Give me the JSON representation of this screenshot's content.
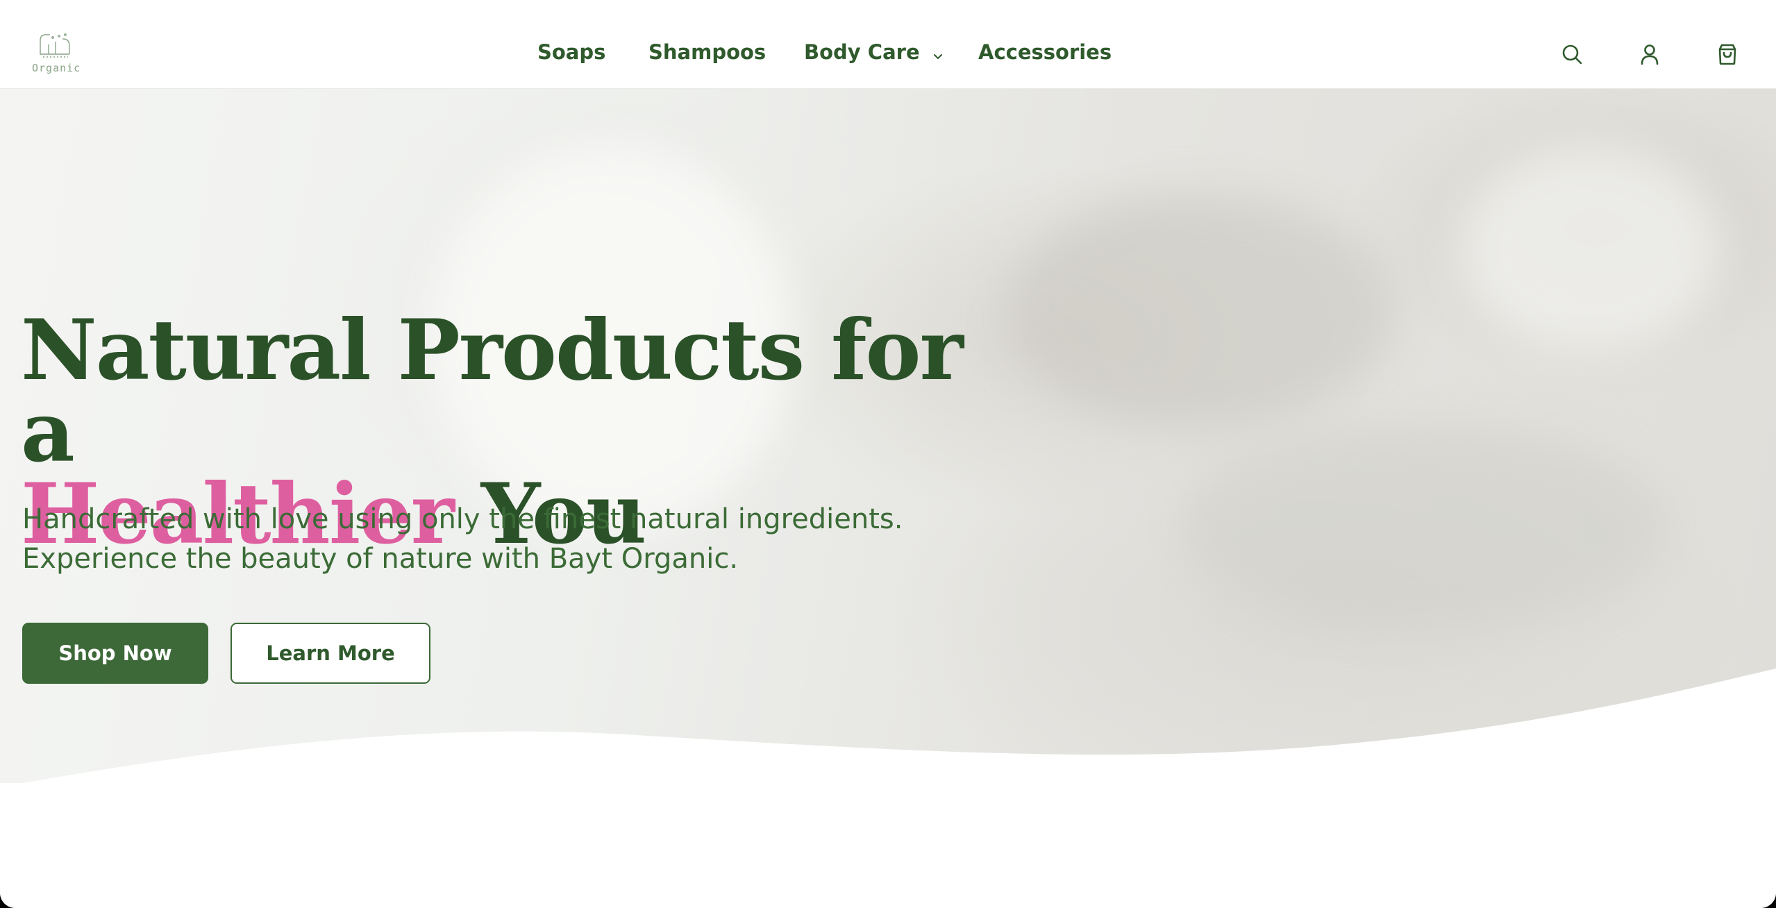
{
  "brand": {
    "logo_text": "Organic",
    "name": "Bayt Organic"
  },
  "nav": {
    "items": [
      {
        "label": "Soaps",
        "has_dropdown": false
      },
      {
        "label": "Shampoos",
        "has_dropdown": false
      },
      {
        "label": "Body Care",
        "has_dropdown": true
      },
      {
        "label": "Accessories",
        "has_dropdown": false
      }
    ]
  },
  "header_icons": [
    "search-icon",
    "user-icon",
    "shopping-bag-icon"
  ],
  "hero": {
    "headline_line1": "Natural Products for a",
    "headline_accent": "Healthier",
    "headline_end": "You",
    "subtitle_line1": "Handcrafted with love using only the finest natural ingredients.",
    "subtitle_line2": "Experience the beauty of nature with Bayt Organic.",
    "primary_button": "Shop Now",
    "secondary_button": "Learn More"
  },
  "colors": {
    "brand_green": "#3c6937",
    "heading_green": "#2b5128",
    "accent_pink": "#de5fa0",
    "background": "#ffffff"
  }
}
